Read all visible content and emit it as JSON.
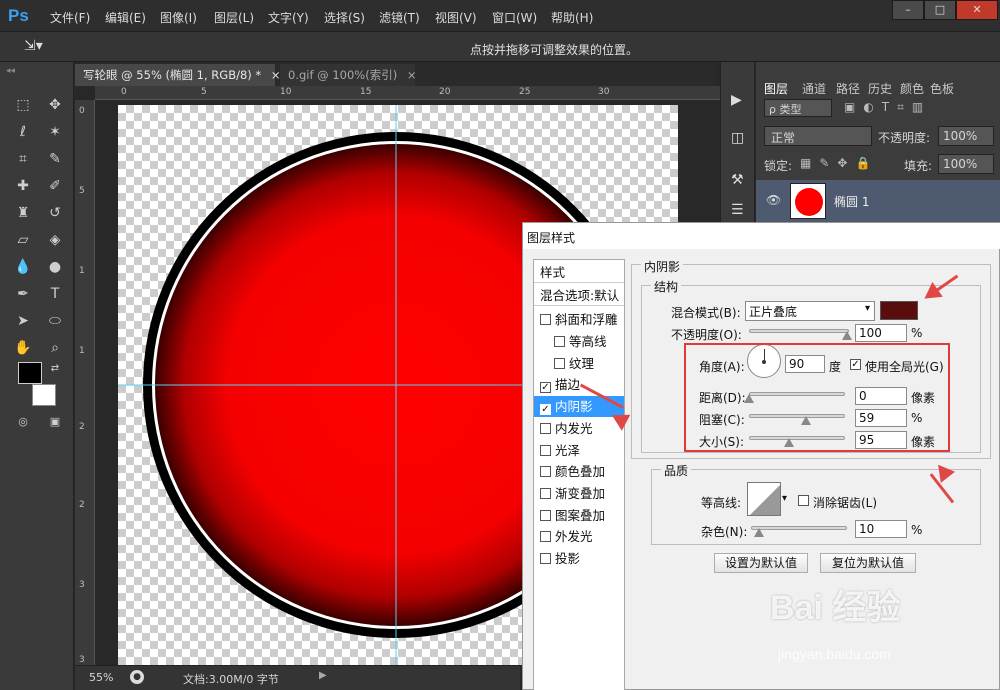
{
  "menubar": {
    "logo": "Ps",
    "items": [
      "文件(F)",
      "编辑(E)",
      "图像(I)",
      "图层(L)",
      "文字(Y)",
      "选择(S)",
      "滤镜(T)",
      "视图(V)",
      "窗口(W)",
      "帮助(H)"
    ],
    "window_controls": [
      "–",
      "□",
      "✕"
    ]
  },
  "optbar": {
    "hint": "点按并拖移可调整效果的位置。"
  },
  "tabs": [
    {
      "label": "写轮眼 @ 55% (椭圆 1, RGB/8) *",
      "close": "×",
      "active": true
    },
    {
      "label": "0.gif @ 100%(索引)",
      "close": "×",
      "active": false
    }
  ],
  "ruler": {
    "top": [
      "0",
      "5",
      "10",
      "15",
      "20",
      "25",
      "30"
    ],
    "left": [
      "0",
      "5",
      "1",
      "1",
      "2",
      "2",
      "3",
      "3"
    ]
  },
  "status": {
    "zoom": "55%",
    "doc": "文档:3.00M/0 字节"
  },
  "layers_panel": {
    "tabs": [
      "图层",
      "通道",
      "路径",
      "历史",
      "颜色",
      "色板"
    ],
    "filter_kind": "ρ 类型",
    "blend_mode": "正常",
    "opacity_label": "不透明度:",
    "opacity_value": "100%",
    "lock_label": "锁定:",
    "fill_label": "填充:",
    "fill_value": "100%",
    "layer_name": "椭圆 1"
  },
  "dialog": {
    "title": "图层样式",
    "styles_header": "样式",
    "blend_options": "混合选项:默认",
    "styles": [
      {
        "label": "斜面和浮雕",
        "checked": false,
        "indent": false
      },
      {
        "label": "等高线",
        "checked": false,
        "indent": true
      },
      {
        "label": "纹理",
        "checked": false,
        "indent": true
      },
      {
        "label": "描边",
        "checked": true,
        "indent": false
      },
      {
        "label": "内阴影",
        "checked": true,
        "indent": false,
        "selected": true
      },
      {
        "label": "内发光",
        "checked": false,
        "indent": false
      },
      {
        "label": "光泽",
        "checked": false,
        "indent": false
      },
      {
        "label": "颜色叠加",
        "checked": false,
        "indent": false
      },
      {
        "label": "渐变叠加",
        "checked": false,
        "indent": false
      },
      {
        "label": "图案叠加",
        "checked": false,
        "indent": false
      },
      {
        "label": "外发光",
        "checked": false,
        "indent": false
      },
      {
        "label": "投影",
        "checked": false,
        "indent": false
      }
    ],
    "section_title": "内阴影",
    "structure": {
      "title": "结构",
      "blend_mode_label": "混合模式(B):",
      "blend_mode_value": "正片叠底",
      "shadow_color": "#5a0d0d",
      "opacity_label": "不透明度(O):",
      "opacity_value": "100",
      "opacity_unit": "%",
      "angle_label": "角度(A):",
      "angle_value": "90",
      "angle_unit": "度",
      "global_light_label": "使用全局光(G)",
      "distance_label": "距离(D):",
      "distance_value": "0",
      "distance_unit": "像素",
      "choke_label": "阻塞(C):",
      "choke_value": "59",
      "choke_unit": "%",
      "size_label": "大小(S):",
      "size_value": "95",
      "size_unit": "像素"
    },
    "quality": {
      "title": "品质",
      "contour_label": "等高线:",
      "antialias_label": "消除锯齿(L)",
      "noise_label": "杂色(N):",
      "noise_value": "10",
      "noise_unit": "%"
    },
    "buttons": {
      "make_default": "设置为默认值",
      "reset_default": "复位为默认值"
    }
  },
  "watermark": {
    "brand": "Bai 经验",
    "url": "jingyan.baidu.com"
  },
  "colors": {
    "accent_red": "#e03a3a",
    "selection_blue": "#3399ff",
    "circle_red": "#ff0000"
  }
}
